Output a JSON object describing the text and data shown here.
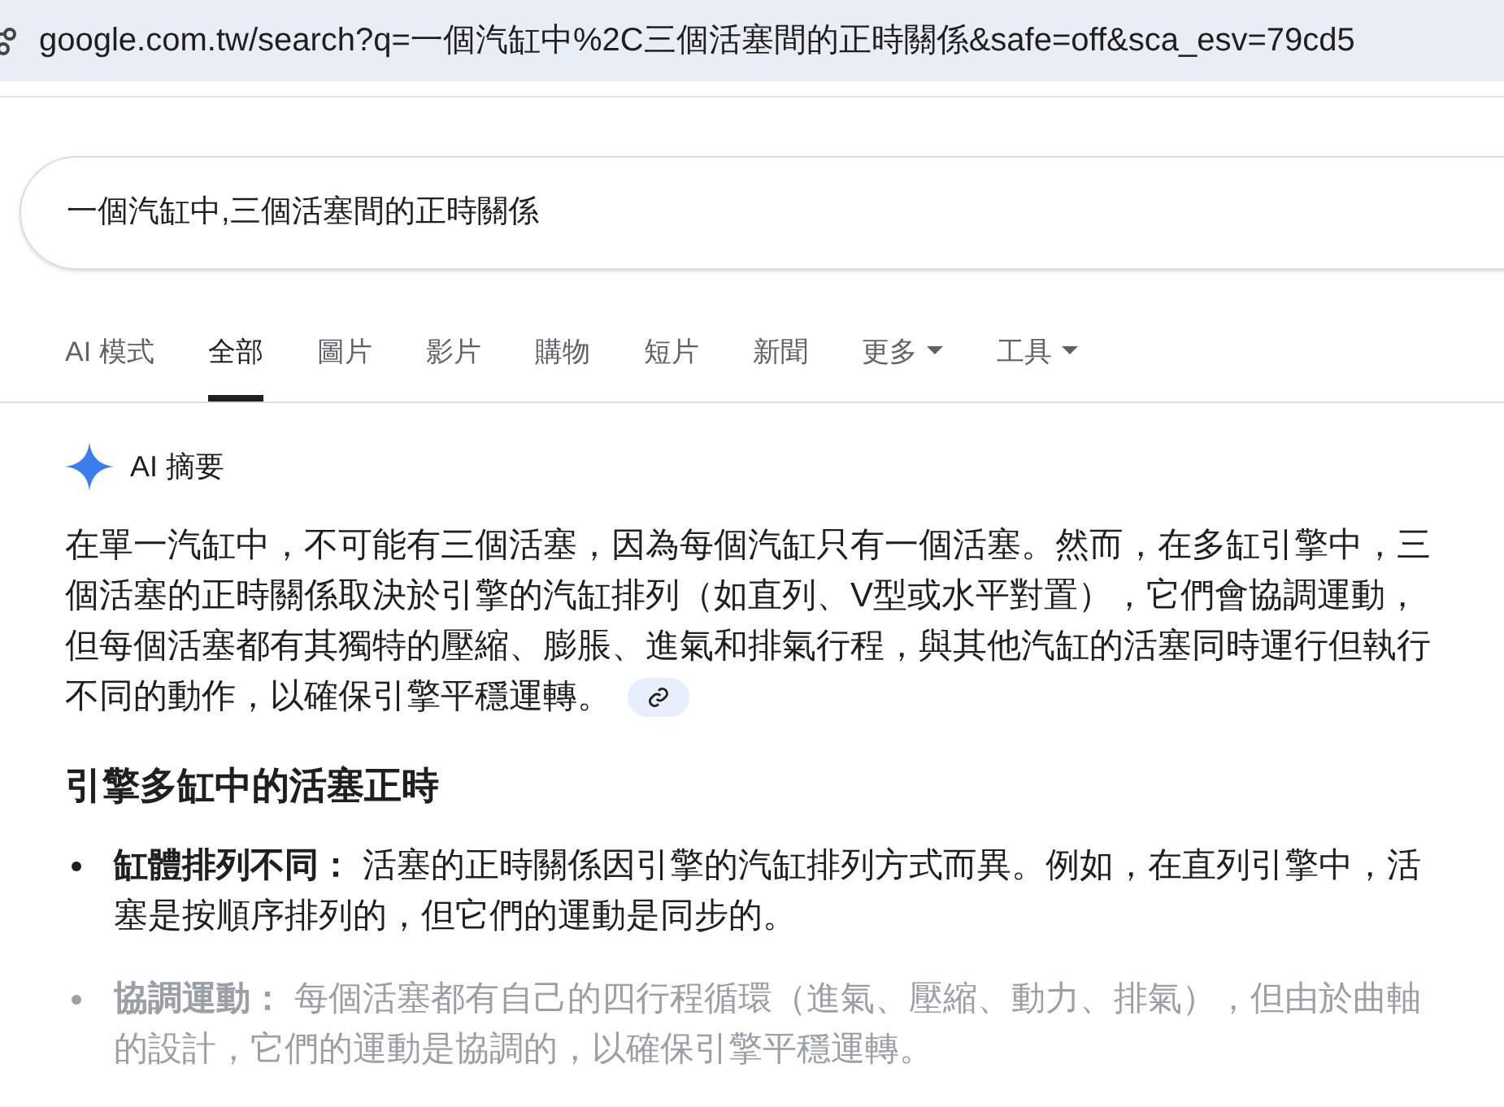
{
  "address_bar": {
    "url": "google.com.tw/search?q=一個汽缸中%2C三個活塞間的正時關係&safe=off&sca_esv=79cd5"
  },
  "search": {
    "value": "一個汽缸中,三個活塞間的正時關係"
  },
  "tabs": [
    {
      "label": "AI 模式",
      "selected": false,
      "dropdown": false
    },
    {
      "label": "全部",
      "selected": true,
      "dropdown": false
    },
    {
      "label": "圖片",
      "selected": false,
      "dropdown": false
    },
    {
      "label": "影片",
      "selected": false,
      "dropdown": false
    },
    {
      "label": "購物",
      "selected": false,
      "dropdown": false
    },
    {
      "label": "短片",
      "selected": false,
      "dropdown": false
    },
    {
      "label": "新聞",
      "selected": false,
      "dropdown": false
    },
    {
      "label": "更多",
      "selected": false,
      "dropdown": true
    },
    {
      "label": "工具",
      "selected": false,
      "dropdown": true
    }
  ],
  "ai_overview": {
    "title": "AI 摘要",
    "summary": "在單一汽缸中，不可能有三個活塞，因為每個汽缸只有一個活塞。然而，在多缸引擎中，三個活塞的正時關係取決於引擎的汽缸排列（如直列、V型或水平對置），它們會協調運動，但每個活塞都有其獨特的壓縮、膨脹、進氣和排氣行程，與其他汽缸的活塞同時運行但執行不同的動作，以確保引擎平穩運轉。",
    "heading": "引擎多缸中的活塞正時",
    "bullets": [
      {
        "text": "**缸體排列不同：** 活塞的正時關係因引擎的汽缸排列方式而異。例如，在直列引擎中，活塞是按順序排列的，但它們的運動是同步的。",
        "faded": false
      },
      {
        "text": "**協調運動：** 每個活塞都有自己的四行程循環（進氣、壓縮、動力、排氣），但由於曲軸的設計，它們的運動是協調的，以確保引擎平穩運轉。",
        "faded": true
      }
    ]
  }
}
